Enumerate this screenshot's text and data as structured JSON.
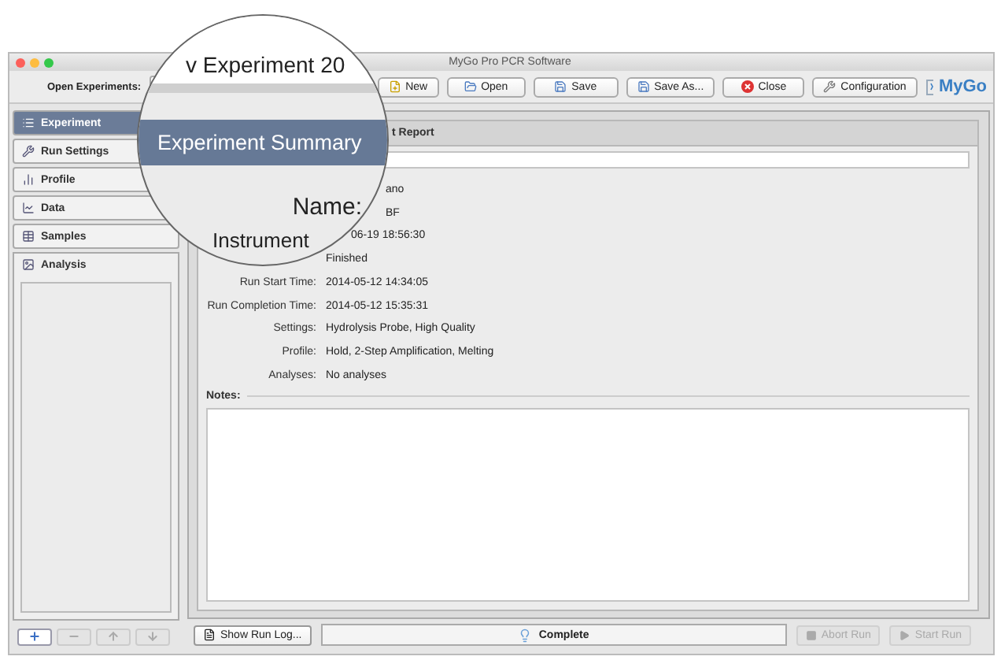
{
  "window": {
    "title": "MyGo Pro PCR Software"
  },
  "toolbar": {
    "open_label": "Open Experiments:",
    "buttons": [
      {
        "label": "New",
        "disabled": false
      },
      {
        "label": "Open",
        "disabled": false
      },
      {
        "label": "Save",
        "disabled": false
      },
      {
        "label": "Save As...",
        "disabled": false
      },
      {
        "label": "Close",
        "disabled": false
      },
      {
        "label": "Configuration",
        "disabled": false
      }
    ],
    "logo": "MyGo"
  },
  "magnifier": {
    "experiment_title": "v Experiment 20",
    "section_header": "Experiment Summary",
    "field_label": "Name:",
    "row_label": "Instrument"
  },
  "sidebar": {
    "items": [
      {
        "label": "Experiment",
        "selected": true,
        "expanded": false
      },
      {
        "label": "Run Settings",
        "selected": false,
        "expanded": false
      },
      {
        "label": "Profile",
        "selected": false,
        "expanded": false
      },
      {
        "label": "Data",
        "selected": false,
        "expanded": false
      },
      {
        "label": "Samples",
        "selected": false,
        "expanded": false
      },
      {
        "label": "Analysis",
        "selected": false,
        "expanded": true
      }
    ],
    "buttons": [
      {
        "disabled": false
      },
      {
        "disabled": true
      },
      {
        "disabled": true
      },
      {
        "disabled": true
      }
    ]
  },
  "report": {
    "tab": "t Report",
    "summary": [
      {
        "value": "ano"
      },
      {
        "value": "BF"
      },
      {
        "value": "06-19 18:56:30"
      },
      {
        "value": "Finished"
      },
      {
        "label": "Run Start Time:",
        "value": "2014-05-12 14:34:05"
      },
      {
        "label": "Run Completion Time:",
        "value": "2014-05-12 15:35:31"
      },
      {
        "label": "Settings:",
        "value": "Hydrolysis Probe, High Quality"
      },
      {
        "label": "Profile:",
        "value": "Hold, 2-Step Amplification, Melting"
      },
      {
        "label": "Analyses:",
        "value": "No analyses"
      }
    ],
    "notes_label": "Notes:"
  },
  "footer": {
    "log_button": "Show Run Log...",
    "status": "Complete",
    "buttons": [
      {
        "label": "Abort Run",
        "disabled": true
      },
      {
        "label": "Start Run",
        "disabled": true
      }
    ]
  }
}
